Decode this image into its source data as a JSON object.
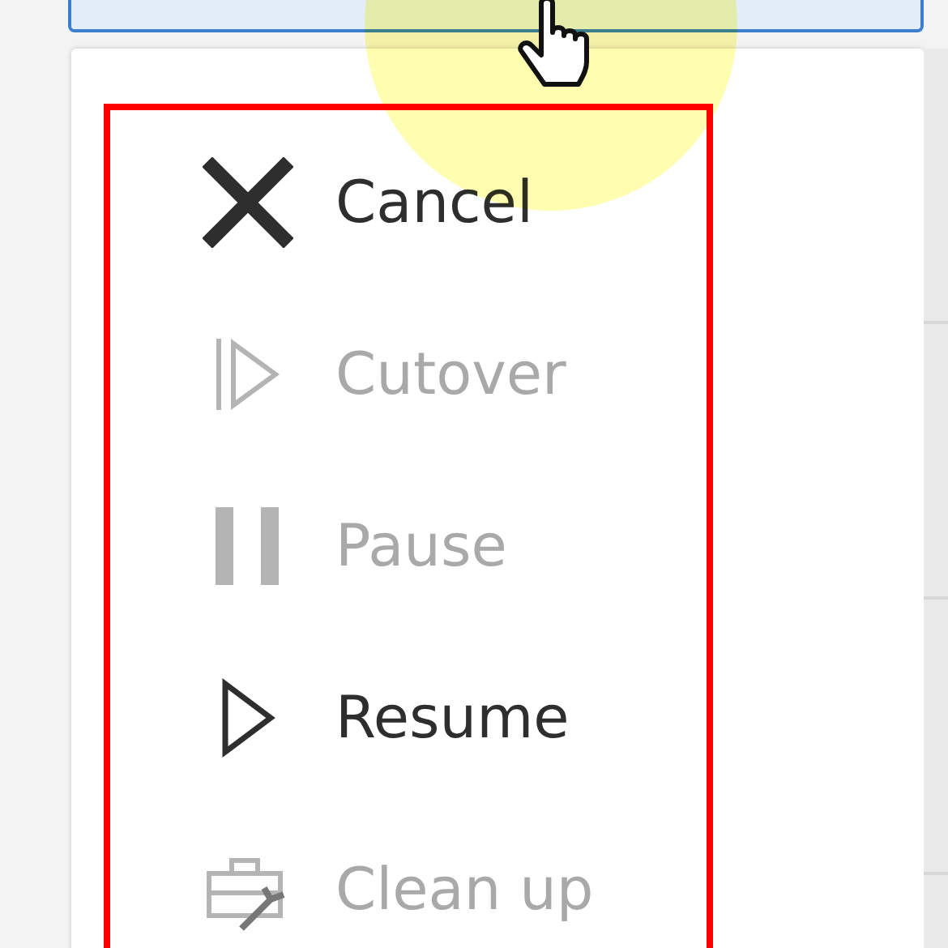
{
  "menu": {
    "items": [
      {
        "kind": "cancel",
        "label": "Cancel",
        "disabled": false
      },
      {
        "kind": "cutover",
        "label": "Cutover",
        "disabled": true
      },
      {
        "kind": "pause",
        "label": "Pause",
        "disabled": true
      },
      {
        "kind": "resume",
        "label": "Resume",
        "disabled": false
      },
      {
        "kind": "cleanup",
        "label": "Clean up",
        "disabled": true
      }
    ]
  }
}
